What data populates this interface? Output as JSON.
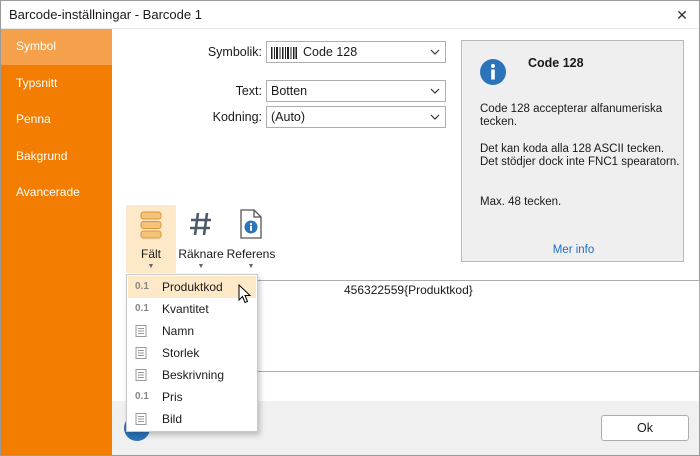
{
  "window": {
    "title": "Barcode-inställningar - Barcode 1",
    "close_glyph": "✕"
  },
  "sidebar": {
    "items": [
      {
        "label": "Symbol",
        "active": true
      },
      {
        "label": "Typsnitt",
        "active": false
      },
      {
        "label": "Penna",
        "active": false
      },
      {
        "label": "Bakgrund",
        "active": false
      },
      {
        "label": "Avancerade",
        "active": false
      }
    ]
  },
  "form": {
    "symbology_label": "Symbolik:",
    "symbology_value": "Code 128",
    "text_label": "Text:",
    "text_value": "Botten",
    "encoding_label": "Kodning:",
    "encoding_value": "(Auto)"
  },
  "info": {
    "title": "Code 128",
    "p1": "Code 128 accepterar alfanumeriska tecken.",
    "p2": "Det kan koda alla 128 ASCII tecken. Det stödjer dock inte FNC1 spearatorn.",
    "p3": "Max. 48 tecken.",
    "more_info": "Mer info"
  },
  "toolbar": {
    "field_label": "Fält",
    "counter_label": "Räknare",
    "reference_label": "Referens"
  },
  "editor": {
    "value": "456322559{Produktkod}"
  },
  "field_menu": {
    "items": [
      {
        "label": "Produktkod",
        "icon": "numeric-field-icon",
        "glyph": "0.1",
        "selected": true
      },
      {
        "label": "Kvantitet",
        "icon": "numeric-field-icon",
        "glyph": "0.1",
        "selected": false
      },
      {
        "label": "Namn",
        "icon": "text-field-icon",
        "glyph": "",
        "selected": false
      },
      {
        "label": "Storlek",
        "icon": "text-field-icon",
        "glyph": "",
        "selected": false
      },
      {
        "label": "Beskrivning",
        "icon": "text-field-icon",
        "glyph": "",
        "selected": false
      },
      {
        "label": "Pris",
        "icon": "numeric-field-icon",
        "glyph": "0.1",
        "selected": false
      },
      {
        "label": "Bild",
        "icon": "text-field-icon",
        "glyph": "",
        "selected": false
      }
    ]
  },
  "footer": {
    "ok_label": "Ok"
  },
  "colors": {
    "accent": "#f27d00",
    "accent_light": "#f5a04a",
    "link": "#1a6fc9",
    "highlight": "#fde9c8"
  }
}
